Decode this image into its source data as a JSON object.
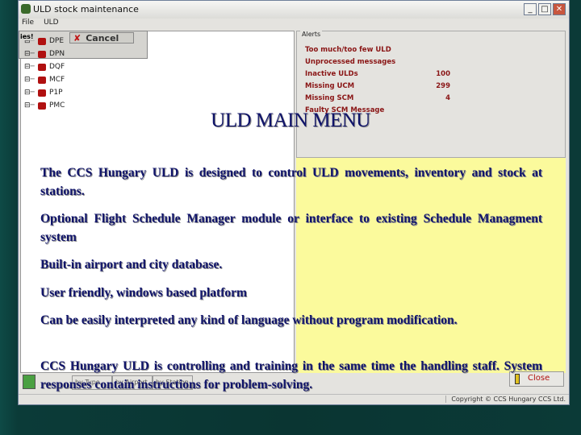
{
  "window": {
    "title": "ULD stock maintenance",
    "menu": [
      "File",
      "ULD"
    ],
    "min": "_",
    "max": "□",
    "close": "✕"
  },
  "tree": {
    "items": [
      "DPE",
      "DPN",
      "DQF",
      "MCF",
      "P1P",
      "PMC"
    ]
  },
  "popup": {
    "label": "ies!",
    "cancel": "Cancel"
  },
  "alerts": {
    "legend": "Alerts",
    "rows": [
      {
        "label": "Too much/too few ULD",
        "value": ""
      },
      {
        "label": "Unprocessed messages",
        "value": ""
      },
      {
        "label": "Inactive ULDs",
        "value": "100"
      },
      {
        "label": "Missing UCM",
        "value": "299"
      },
      {
        "label": "Missing SCM",
        "value": "4"
      },
      {
        "label": "Faulty SCM Message",
        "value": ""
      }
    ]
  },
  "bottom": {
    "tabs": [
      "by Type",
      "by Airport",
      "by Station"
    ],
    "close": "Close",
    "copyright": "Copyright © CCS Hungary CCS Ltd."
  },
  "slide": {
    "title": "ULD MAIN MENU",
    "paragraphs": [
      "The CCS Hungary ULD is designed to control ULD movements, inventory and stock at stations.",
      "Optional Flight Schedule Manager module or interface to existing Schedule Managment system",
      "Built-in airport and city database.",
      "User friendly, windows based platform",
      "Can be easily interpreted any kind of language without program modification.",
      "CCS Hungary ULD is controlling and training in the same time the handling staff. System responses contain instructions for problem-solving."
    ]
  }
}
